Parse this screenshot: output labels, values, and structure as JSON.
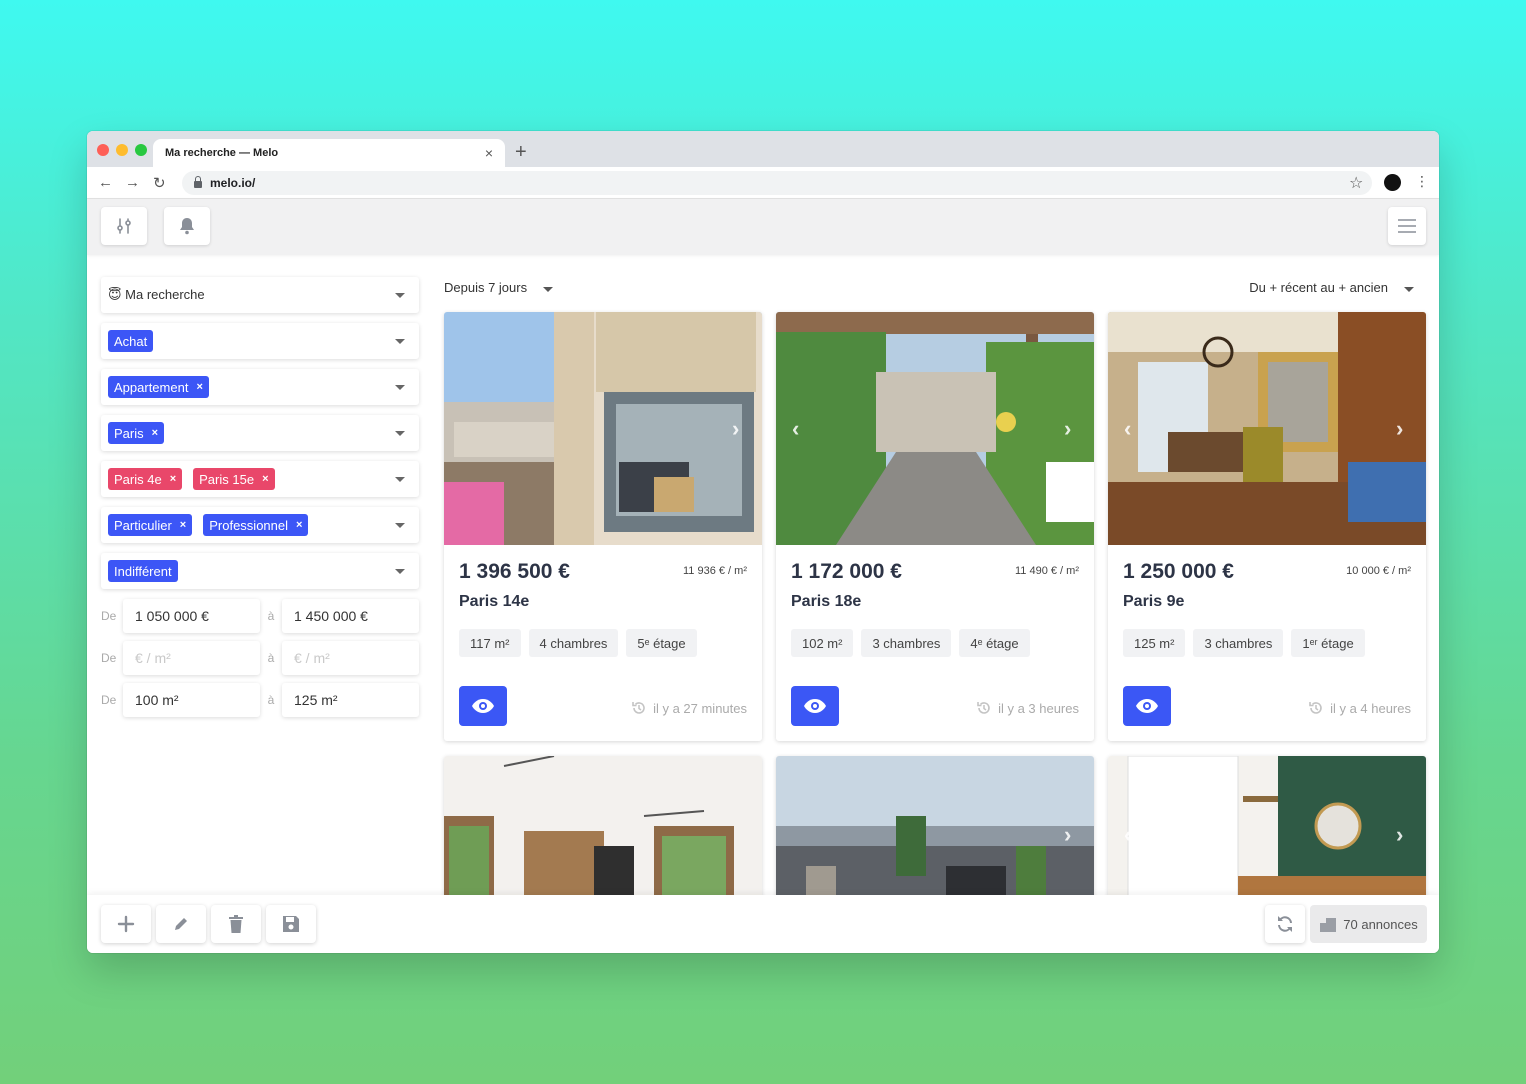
{
  "browser": {
    "tab_title": "Ma recherche — Melo",
    "url": "melo.io/"
  },
  "sidebar": {
    "saved_search": "😇 Ma recherche",
    "transaction": "Achat",
    "property_types": [
      "Appartement"
    ],
    "city_chips": [
      "Paris"
    ],
    "district_chips": [
      "Paris 4e",
      "Paris 15e"
    ],
    "seller_chips": [
      "Particulier",
      "Professionnel"
    ],
    "condition": "Indifférent",
    "price_from": "1 050 000 €",
    "price_to": "1 450 000 €",
    "ppm_placeholder": "€ / m²",
    "surface_from": "100 m²",
    "surface_to": "125 m²",
    "label_from": "De",
    "label_to": "à"
  },
  "main": {
    "period": "Depuis 7 jours",
    "sort": "Du + récent au + ancien",
    "listings": [
      {
        "price": "1 396 500 €",
        "price_per_m2": "11 936 € / m²",
        "city": "Paris 14e",
        "tags": [
          "117 m²",
          "4 chambres",
          "5ᵉ étage"
        ],
        "age": "il y a 27 minutes"
      },
      {
        "price": "1 172 000 €",
        "price_per_m2": "11 490 € / m²",
        "city": "Paris 18e",
        "tags": [
          "102 m²",
          "3 chambres",
          "4ᵉ étage"
        ],
        "age": "il y a 3 heures"
      },
      {
        "price": "1 250 000 €",
        "price_per_m2": "10 000 € / m²",
        "city": "Paris 9e",
        "tags": [
          "125 m²",
          "3 chambres",
          "1ᵉʳ étage"
        ],
        "age": "il y a 4 heures"
      }
    ]
  },
  "footer": {
    "count": "70 annonces"
  },
  "colors": {
    "accent_blue": "#3b57f5",
    "chip_red": "#e9476a"
  }
}
